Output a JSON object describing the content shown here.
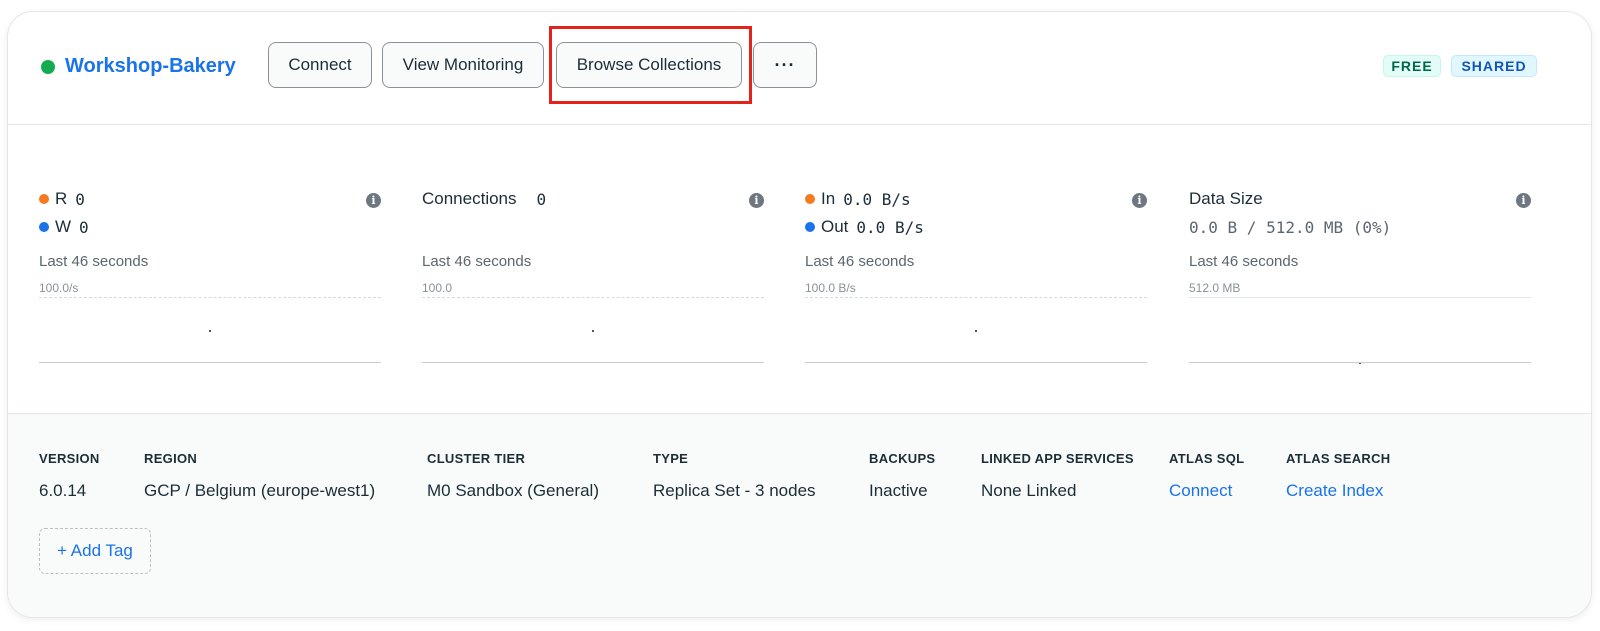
{
  "header": {
    "cluster_name": "Workshop-Bakery",
    "buttons": {
      "connect": "Connect",
      "view_monitoring": "View Monitoring",
      "browse_collections": "Browse Collections",
      "more": "···"
    },
    "badges": {
      "free": "FREE",
      "shared": "SHARED"
    },
    "status_color": "#13aa52"
  },
  "metrics": [
    {
      "r_label": "R",
      "r_value": "0",
      "w_label": "W",
      "w_value": "0",
      "window": "Last 46 seconds",
      "scale": "100.0/s"
    },
    {
      "label": "Connections",
      "value": "0",
      "window": "Last 46 seconds",
      "scale": "100.0"
    },
    {
      "in_label": "In",
      "in_value": "0.0 B/s",
      "out_label": "Out",
      "out_value": "0.0 B/s",
      "window": "Last 46 seconds",
      "scale": "100.0 B/s"
    },
    {
      "label": "Data Size",
      "value": "0.0 B / 512.0 MB (0%)",
      "window": "Last 46 seconds",
      "scale": "512.0 MB"
    }
  ],
  "info_icon": "i",
  "footer": {
    "version": {
      "label": "VERSION",
      "value": "6.0.14"
    },
    "region": {
      "label": "REGION",
      "value": "GCP / Belgium (europe-west1)"
    },
    "cluster_tier": {
      "label": "CLUSTER TIER",
      "value": "M0 Sandbox (General)"
    },
    "type": {
      "label": "TYPE",
      "value": "Replica Set - 3 nodes"
    },
    "backups": {
      "label": "BACKUPS",
      "value": "Inactive"
    },
    "linked_app_services": {
      "label": "LINKED APP SERVICES",
      "value": "None Linked"
    },
    "atlas_sql": {
      "label": "ATLAS SQL",
      "value": "Connect"
    },
    "atlas_search": {
      "label": "ATLAS SEARCH",
      "value": "Create Index"
    },
    "add_tag": "+ Add Tag"
  },
  "colors": {
    "accent": "#1a73e8",
    "highlight": "#e3231b",
    "orange": "#f47a1f"
  }
}
